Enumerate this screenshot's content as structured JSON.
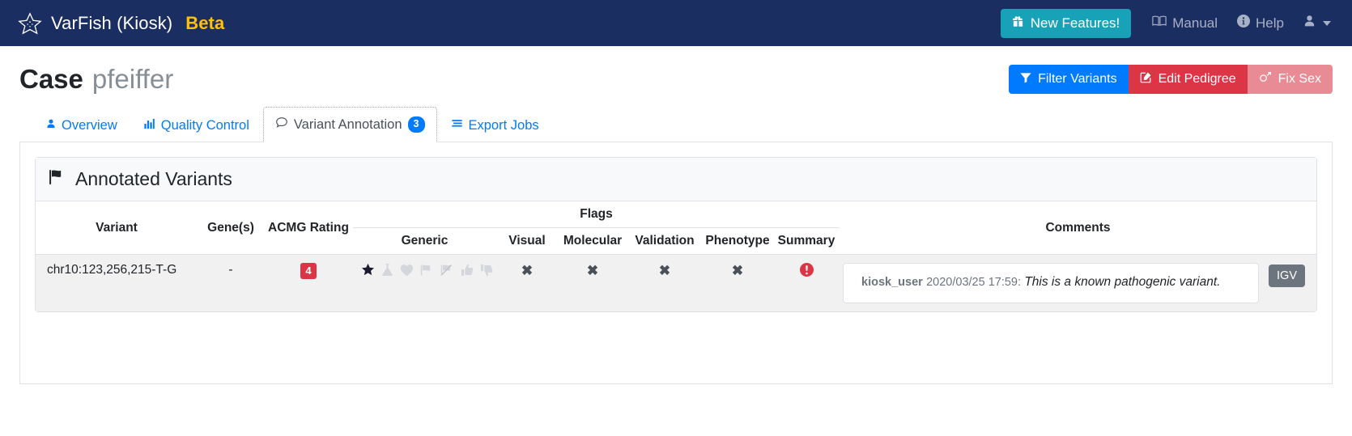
{
  "navbar": {
    "brand_name": "VarFish (Kiosk)",
    "brand_beta": "Beta",
    "new_features_label": "New Features!",
    "manual_label": "Manual",
    "help_label": "Help",
    "brand_icon": "starfish-icon",
    "new_features_icon": "gift-icon",
    "manual_icon": "book-icon",
    "help_icon": "info-circle-icon",
    "user_icon": "user-icon",
    "caret_icon": "caret-down-icon",
    "background_color": "#1b2e62",
    "new_features_color": "#17a2b8",
    "beta_color": "#ffc107"
  },
  "page": {
    "title": "Case",
    "subtitle": "pfeiffer",
    "actions": [
      {
        "label": "Filter Variants",
        "icon": "filter-icon",
        "color": "#007bff"
      },
      {
        "label": "Edit Pedigree",
        "icon": "edit-square-icon",
        "color": "#dc3545"
      },
      {
        "label": "Fix Sex",
        "icon": "venus-mars-icon",
        "color": "#e88b94"
      }
    ]
  },
  "tabs": [
    {
      "label": "Overview",
      "icon": "user-icon",
      "active": false
    },
    {
      "label": "Quality Control",
      "icon": "bar-chart-icon",
      "active": false
    },
    {
      "label": "Variant Annotation",
      "icon": "comment-icon",
      "active": true,
      "badge": "3"
    },
    {
      "label": "Export Jobs",
      "icon": "list-icon",
      "active": false
    }
  ],
  "card": {
    "title": "Annotated Variants",
    "icon": "flag-icon"
  },
  "table": {
    "headers": {
      "variant": "Variant",
      "genes": "Gene(s)",
      "acmg": "ACMG Rating",
      "flags_group": "Flags",
      "comments": "Comments",
      "generic": "Generic",
      "visual": "Visual",
      "molecular": "Molecular",
      "validation": "Validation",
      "phenotype": "Phenotype",
      "summary": "Summary"
    },
    "rows": [
      {
        "variant": "chr10:123,256,215-T-G",
        "genes": "-",
        "acmg_rating": "4",
        "acmg_color": "#dc3545",
        "generic_flags": [
          {
            "icon": "star-icon",
            "active": true
          },
          {
            "icon": "flask-icon",
            "active": false
          },
          {
            "icon": "heart-icon",
            "active": false
          },
          {
            "icon": "flag-icon",
            "active": false
          },
          {
            "icon": "flag-slash-icon",
            "active": false
          },
          {
            "icon": "thumbs-up-icon",
            "active": false
          },
          {
            "icon": "thumbs-down-icon",
            "active": false
          }
        ],
        "visual": "✖",
        "molecular": "✖",
        "validation": "✖",
        "phenotype": "✖",
        "summary_icon": "exclamation-circle-icon",
        "summary_color": "#dc3545",
        "comment_user": "kiosk_user",
        "comment_date": "2020/03/25 17:59:",
        "comment_text": "This is a known pathogenic variant.",
        "igv_label": "IGV"
      }
    ]
  }
}
